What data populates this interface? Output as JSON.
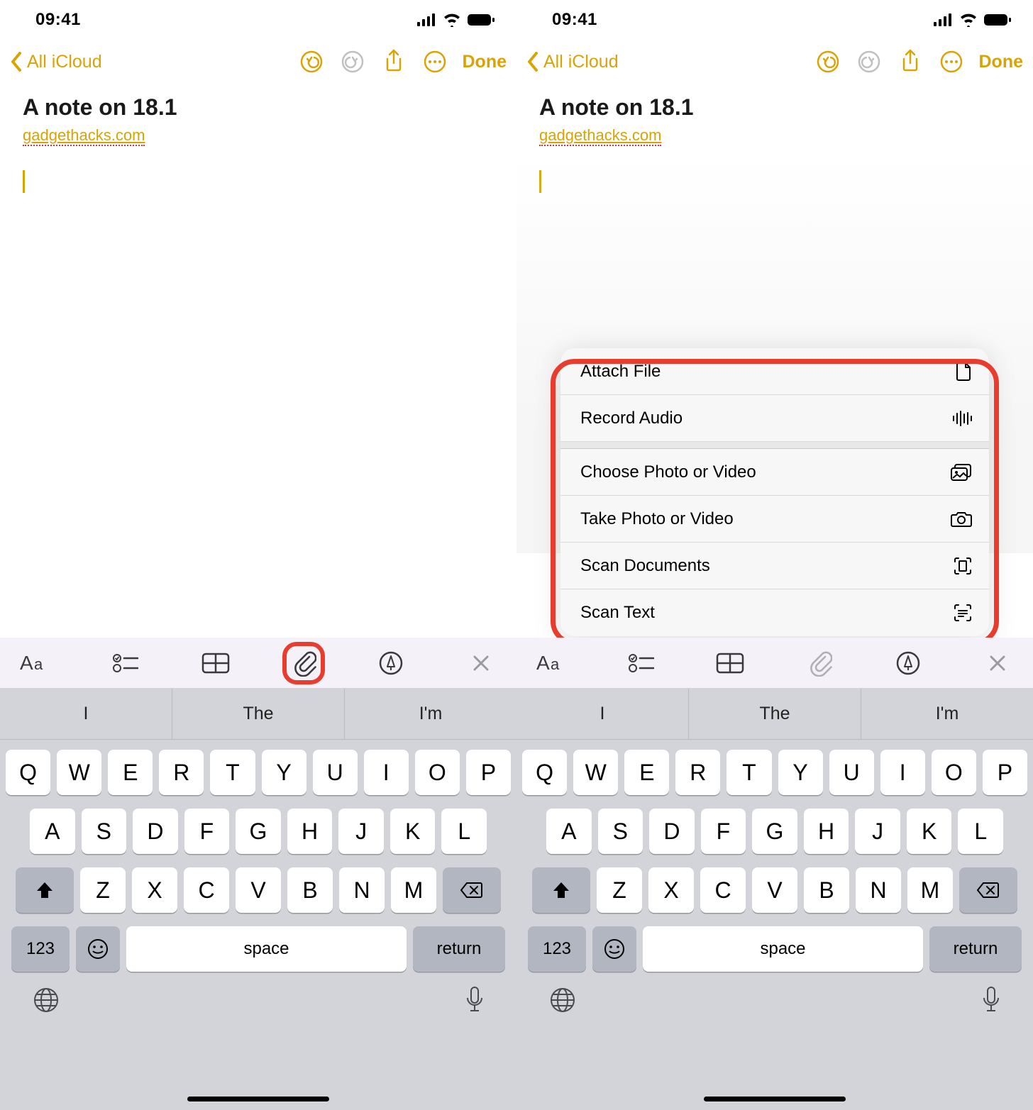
{
  "status": {
    "time": "09:41"
  },
  "nav": {
    "back_label": "All iCloud",
    "done_label": "Done"
  },
  "note": {
    "title": "A note on 18.1",
    "link": "gadgethacks.com"
  },
  "suggestions": [
    "I",
    "The",
    "I'm"
  ],
  "keyboard": {
    "row1": [
      "Q",
      "W",
      "E",
      "R",
      "T",
      "Y",
      "U",
      "I",
      "O",
      "P"
    ],
    "row2": [
      "A",
      "S",
      "D",
      "F",
      "G",
      "H",
      "J",
      "K",
      "L"
    ],
    "row3": [
      "Z",
      "X",
      "C",
      "V",
      "B",
      "N",
      "M"
    ],
    "numkey": "123",
    "space": "space",
    "return": "return"
  },
  "menu": {
    "items": [
      {
        "label": "Attach File",
        "icon": "document-icon"
      },
      {
        "label": "Record Audio",
        "icon": "waveform-icon"
      },
      {
        "label": "Choose Photo or Video",
        "icon": "photos-icon"
      },
      {
        "label": "Take Photo or Video",
        "icon": "camera-icon"
      },
      {
        "label": "Scan Documents",
        "icon": "scan-doc-icon"
      },
      {
        "label": "Scan Text",
        "icon": "scan-text-icon"
      }
    ]
  }
}
